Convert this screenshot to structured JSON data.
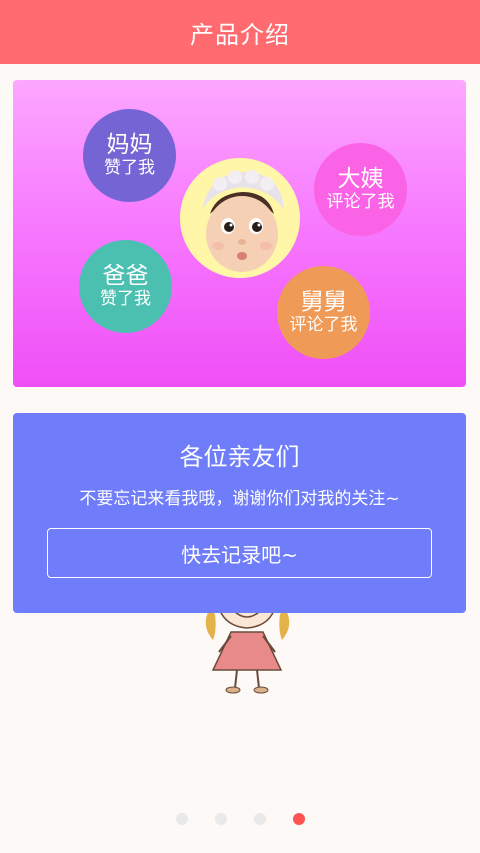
{
  "header": {
    "title": "产品介绍"
  },
  "hero": {
    "bubbles": [
      {
        "who": "妈妈",
        "action": "赞了我",
        "color": "#7565d4"
      },
      {
        "who": "大姨",
        "action": "评论了我",
        "color": "#fb63e6"
      },
      {
        "who": "爸爸",
        "action": "赞了我",
        "color": "#4cc0b0"
      },
      {
        "who": "舅舅",
        "action": "评论了我",
        "color": "#ef9a56"
      }
    ]
  },
  "card": {
    "title": "各位亲友们",
    "message": "不要忘记来看我哦，谢谢你们对我的关注~",
    "button_label": "快去记录吧~"
  },
  "pager": {
    "total": 4,
    "active_index": 3
  },
  "colors": {
    "header": "#ff6b6f",
    "card": "#6f7dfb",
    "active_dot": "#ff5252"
  }
}
